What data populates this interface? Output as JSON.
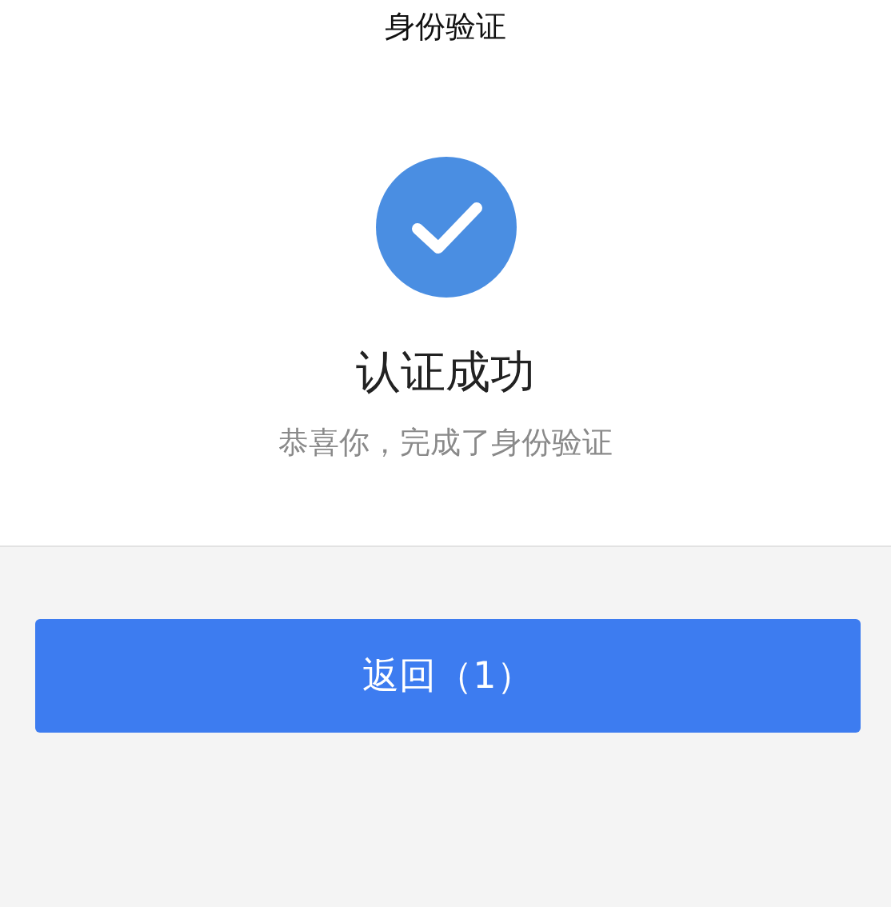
{
  "header": {
    "title": "身份验证"
  },
  "result": {
    "success": true,
    "heading": "认证成功",
    "message": "恭喜你，完成了身份验证"
  },
  "buttons": [
    {
      "label": "返回（1）"
    }
  ]
}
